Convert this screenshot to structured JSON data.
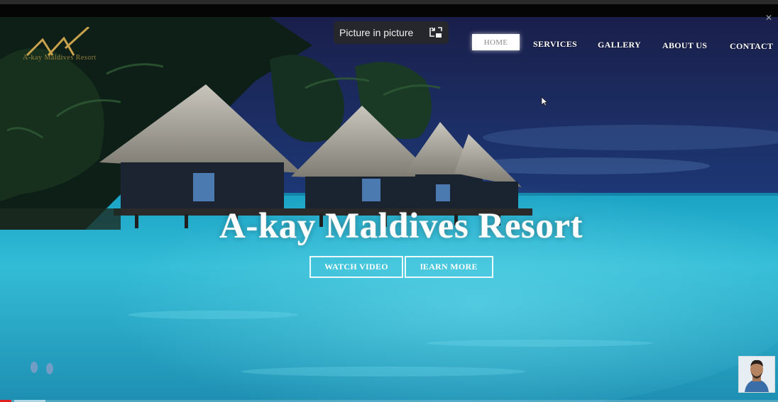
{
  "pip": {
    "label": "Picture in picture",
    "icon": "pip-exit-icon"
  },
  "logo": {
    "text": "A-kay Maldives Resort"
  },
  "nav": {
    "items": [
      {
        "label": "HOME",
        "active": true
      },
      {
        "label": "SERVICES"
      },
      {
        "label": "GALLERY"
      },
      {
        "label": "ABOUT US"
      },
      {
        "label": "CONTACT"
      }
    ]
  },
  "hero": {
    "title": "A-kay Maldives Resort",
    "buttons": {
      "watch": "WATCH VIDEO",
      "learn": "lEARN MORE"
    }
  },
  "video": {
    "progress": 0.015,
    "accent": "#e02020"
  },
  "colors": {
    "sea": "#2fb2cf",
    "sky": "#16224a",
    "thatch": "#9c9a92"
  }
}
